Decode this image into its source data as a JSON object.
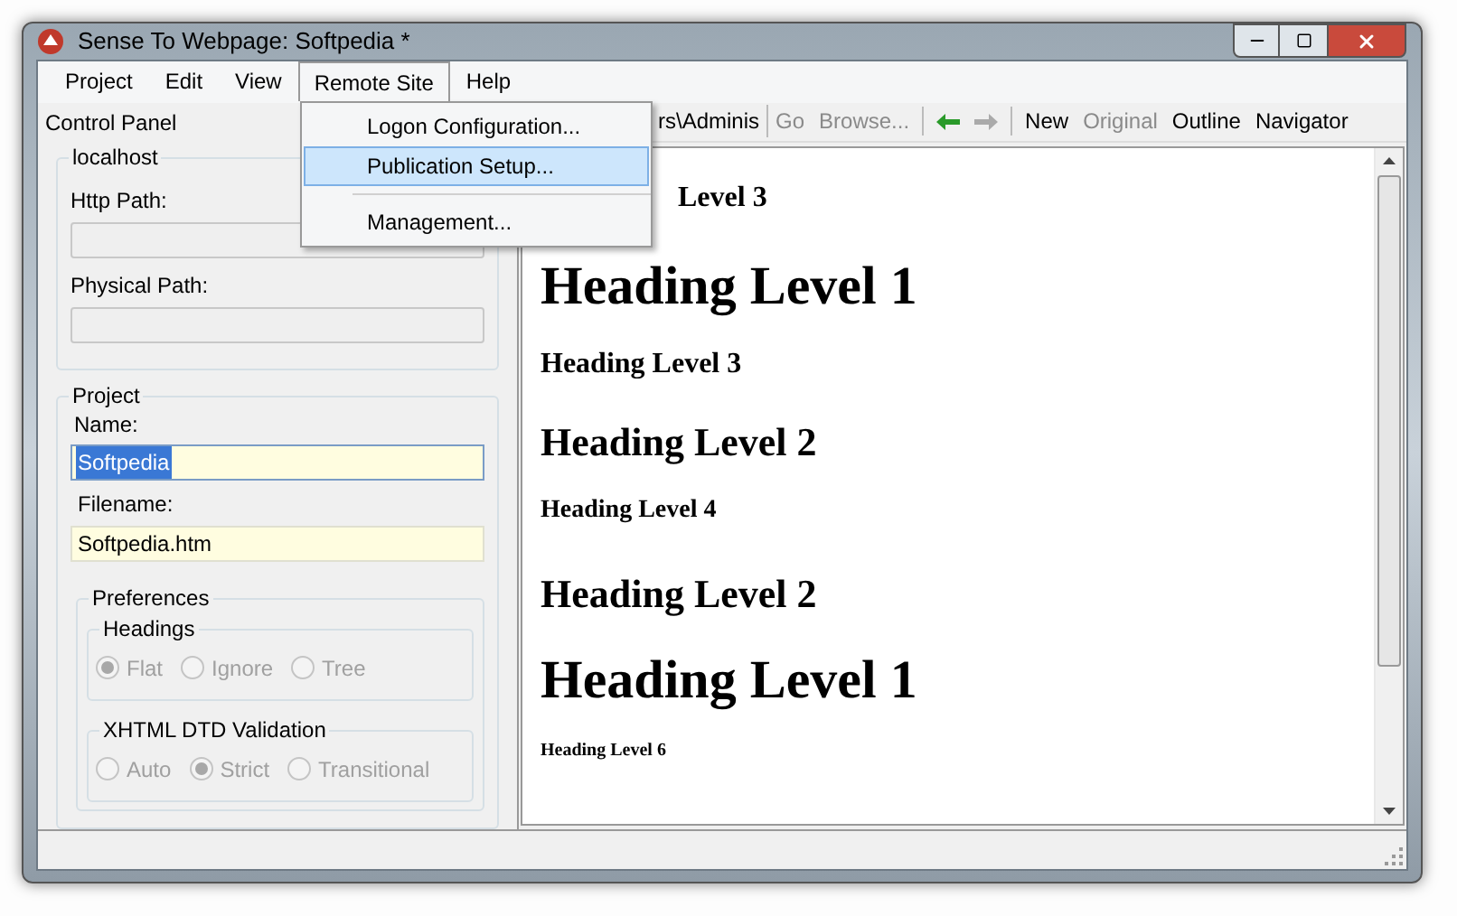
{
  "window": {
    "title": "Sense To Webpage: Softpedia *"
  },
  "menu": [
    {
      "label": "Project",
      "selected": false
    },
    {
      "label": "Edit",
      "selected": false
    },
    {
      "label": "View",
      "selected": false
    },
    {
      "label": "Remote Site",
      "selected": true
    },
    {
      "label": "Help",
      "selected": false
    }
  ],
  "dropdown": [
    {
      "kind": "item",
      "label": "Logon Configuration...",
      "selected": false
    },
    {
      "kind": "item",
      "label": "Publication Setup...",
      "selected": true
    },
    {
      "kind": "separator"
    },
    {
      "kind": "item",
      "label": "Management...",
      "selected": false
    }
  ],
  "control_panel": {
    "title": "Control Panel",
    "server": {
      "title": "localhost",
      "http_path_label": "Http Path:",
      "physical_path_label": "Physical Path:"
    },
    "project": {
      "title": "Project",
      "name_label": "Name:",
      "name_value": "Softpedia",
      "filename_label": "Filename:",
      "filename_value": "Softpedia.htm",
      "preferences": {
        "title": "Preferences",
        "groups": [
          {
            "title": "Headings",
            "options": [
              {
                "label": "Flat",
                "selected": true
              },
              {
                "label": "Ignore",
                "selected": false
              },
              {
                "label": "Tree",
                "selected": false
              }
            ]
          },
          {
            "title": "XHTML DTD Validation",
            "options": [
              {
                "label": "Auto",
                "selected": false
              },
              {
                "label": "Strict",
                "selected": true
              },
              {
                "label": "Transitional",
                "selected": false
              }
            ]
          }
        ]
      }
    }
  },
  "toolbar": {
    "path": "rs\\Adminis",
    "items": [
      {
        "kind": "text",
        "label": "Go",
        "disabled": true
      },
      {
        "kind": "text",
        "label": "Browse...",
        "disabled": true
      },
      {
        "kind": "separator"
      },
      {
        "kind": "back",
        "disabled": false
      },
      {
        "kind": "forward",
        "disabled": true
      },
      {
        "kind": "separator"
      },
      {
        "kind": "text",
        "label": "New",
        "disabled": false
      },
      {
        "kind": "text",
        "label": "Original",
        "disabled": true
      },
      {
        "kind": "text",
        "label": "Outline",
        "disabled": false
      },
      {
        "kind": "text",
        "label": "Navigator",
        "disabled": false
      }
    ]
  },
  "document": [
    {
      "kind": "h3",
      "text": "Level 3"
    },
    {
      "kind": "h1",
      "text": "Heading Level 1"
    },
    {
      "kind": "h3",
      "text": "Heading Level 3"
    },
    {
      "kind": "h2",
      "text": "Heading Level 2"
    },
    {
      "kind": "h4",
      "text": "Heading Level 4"
    },
    {
      "kind": "h2",
      "text": "Heading Level 2"
    },
    {
      "kind": "h1",
      "text": "Heading Level 1"
    },
    {
      "kind": "h6",
      "text": "Heading Level 6"
    }
  ]
}
